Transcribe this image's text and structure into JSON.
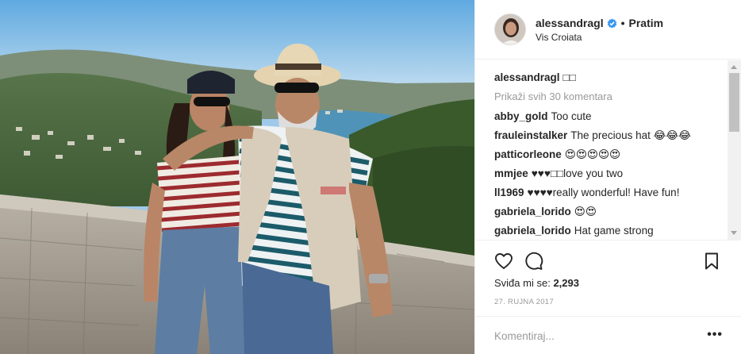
{
  "post": {
    "photo_alt": "Two people posing in front of a stone wall with a coastal town and sea behind"
  },
  "header": {
    "username": "alessandragl",
    "separator": "•",
    "follow_label": "Pratim",
    "location": "Vis Croiata"
  },
  "comments": {
    "caption": {
      "user": "alessandragl",
      "text": "□□"
    },
    "load_more": "Prikaži svih 30 komentara",
    "items": [
      {
        "user": "abby_gold",
        "text": "Too cute"
      },
      {
        "user": "frauleinstalker",
        "text": "The precious hat 😂😂😂"
      },
      {
        "user": "patticorleone",
        "text": "😍😍😍😍😍"
      },
      {
        "user": "mmjee",
        "text": "♥♥♥□□love you two"
      },
      {
        "user": "ll1969",
        "text": "♥♥♥♥really wonderful! Have fun!"
      },
      {
        "user": "gabriela_lorido",
        "text": "😍😍"
      },
      {
        "user": "gabriela_lorido",
        "text": "Hat game strong"
      }
    ]
  },
  "actions": {
    "likes_label": "Sviđa mi se:",
    "likes_count": "2,293",
    "date": "27. RUJNA 2017",
    "icons": [
      "heart-icon",
      "comment-icon",
      "bookmark-icon"
    ]
  },
  "comment_box": {
    "placeholder": "Komentiraj...",
    "more_label": "•••"
  },
  "colors": {
    "verified_badge": "#3897f0",
    "text_primary": "#262626",
    "text_muted": "#999999",
    "divider": "#efefef"
  }
}
